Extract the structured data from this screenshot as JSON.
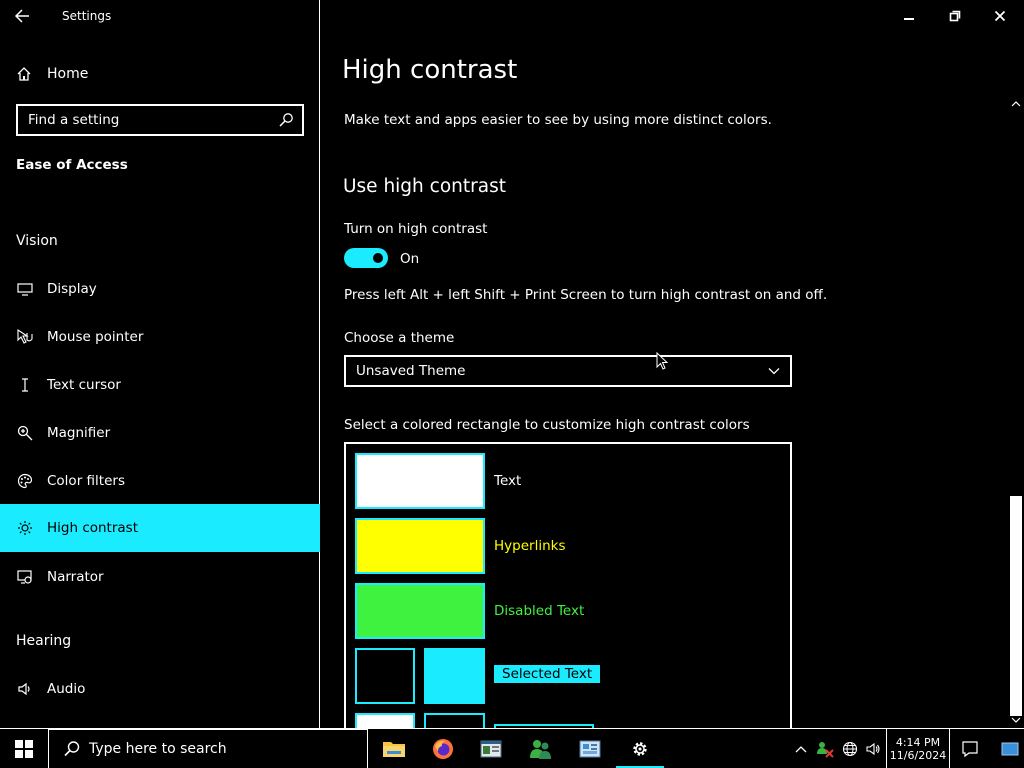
{
  "window": {
    "app_title": "Settings",
    "controls": {
      "minimize": "minimize-icon",
      "restore": "restore-icon",
      "close": "close-icon"
    }
  },
  "sidebar": {
    "home_label": "Home",
    "search_placeholder": "Find a setting",
    "section_title": "Ease of Access",
    "groups": {
      "vision": "Vision",
      "hearing": "Hearing"
    },
    "items": [
      {
        "label": "Display",
        "icon": "monitor-icon"
      },
      {
        "label": "Mouse pointer",
        "icon": "mouse-pointer-icon"
      },
      {
        "label": "Text cursor",
        "icon": "text-cursor-icon"
      },
      {
        "label": "Magnifier",
        "icon": "magnifier-icon"
      },
      {
        "label": "Color filters",
        "icon": "palette-icon"
      },
      {
        "label": "High contrast",
        "icon": "brightness-icon",
        "selected": true
      },
      {
        "label": "Narrator",
        "icon": "narrator-icon"
      },
      {
        "label": "Audio",
        "icon": "speaker-icon"
      }
    ]
  },
  "main": {
    "page_title": "High contrast",
    "description": "Make text and apps easier to see by using more distinct colors.",
    "section_title": "Use high contrast",
    "toggle_label": "Turn on high contrast",
    "toggle_state": "On",
    "shortcut_hint": "Press left Alt + left Shift + Print Screen to turn high contrast on and off.",
    "theme_label": "Choose a theme",
    "theme_value": "Unsaved Theme",
    "colors_label": "Select a colored rectangle to customize high contrast colors",
    "colors": {
      "text": {
        "label": "Text",
        "color": "#ffffff"
      },
      "hyperlinks": {
        "label": "Hyperlinks",
        "color": "#ffff00"
      },
      "disabled_text": {
        "label": "Disabled Text",
        "color": "#3ff23f"
      },
      "selected_text": {
        "label": "Selected Text",
        "fg": "#000000",
        "bg": "#1aebff"
      }
    }
  },
  "accent_color": "#1aebff",
  "taskbar": {
    "search_placeholder": "Type here to search",
    "apps": [
      "file-explorer-icon",
      "firefox-icon",
      "app-window-icon",
      "people-icon",
      "control-panel-icon",
      "settings-gear-icon"
    ],
    "time": "4:14 PM",
    "date": "11/6/2024"
  }
}
